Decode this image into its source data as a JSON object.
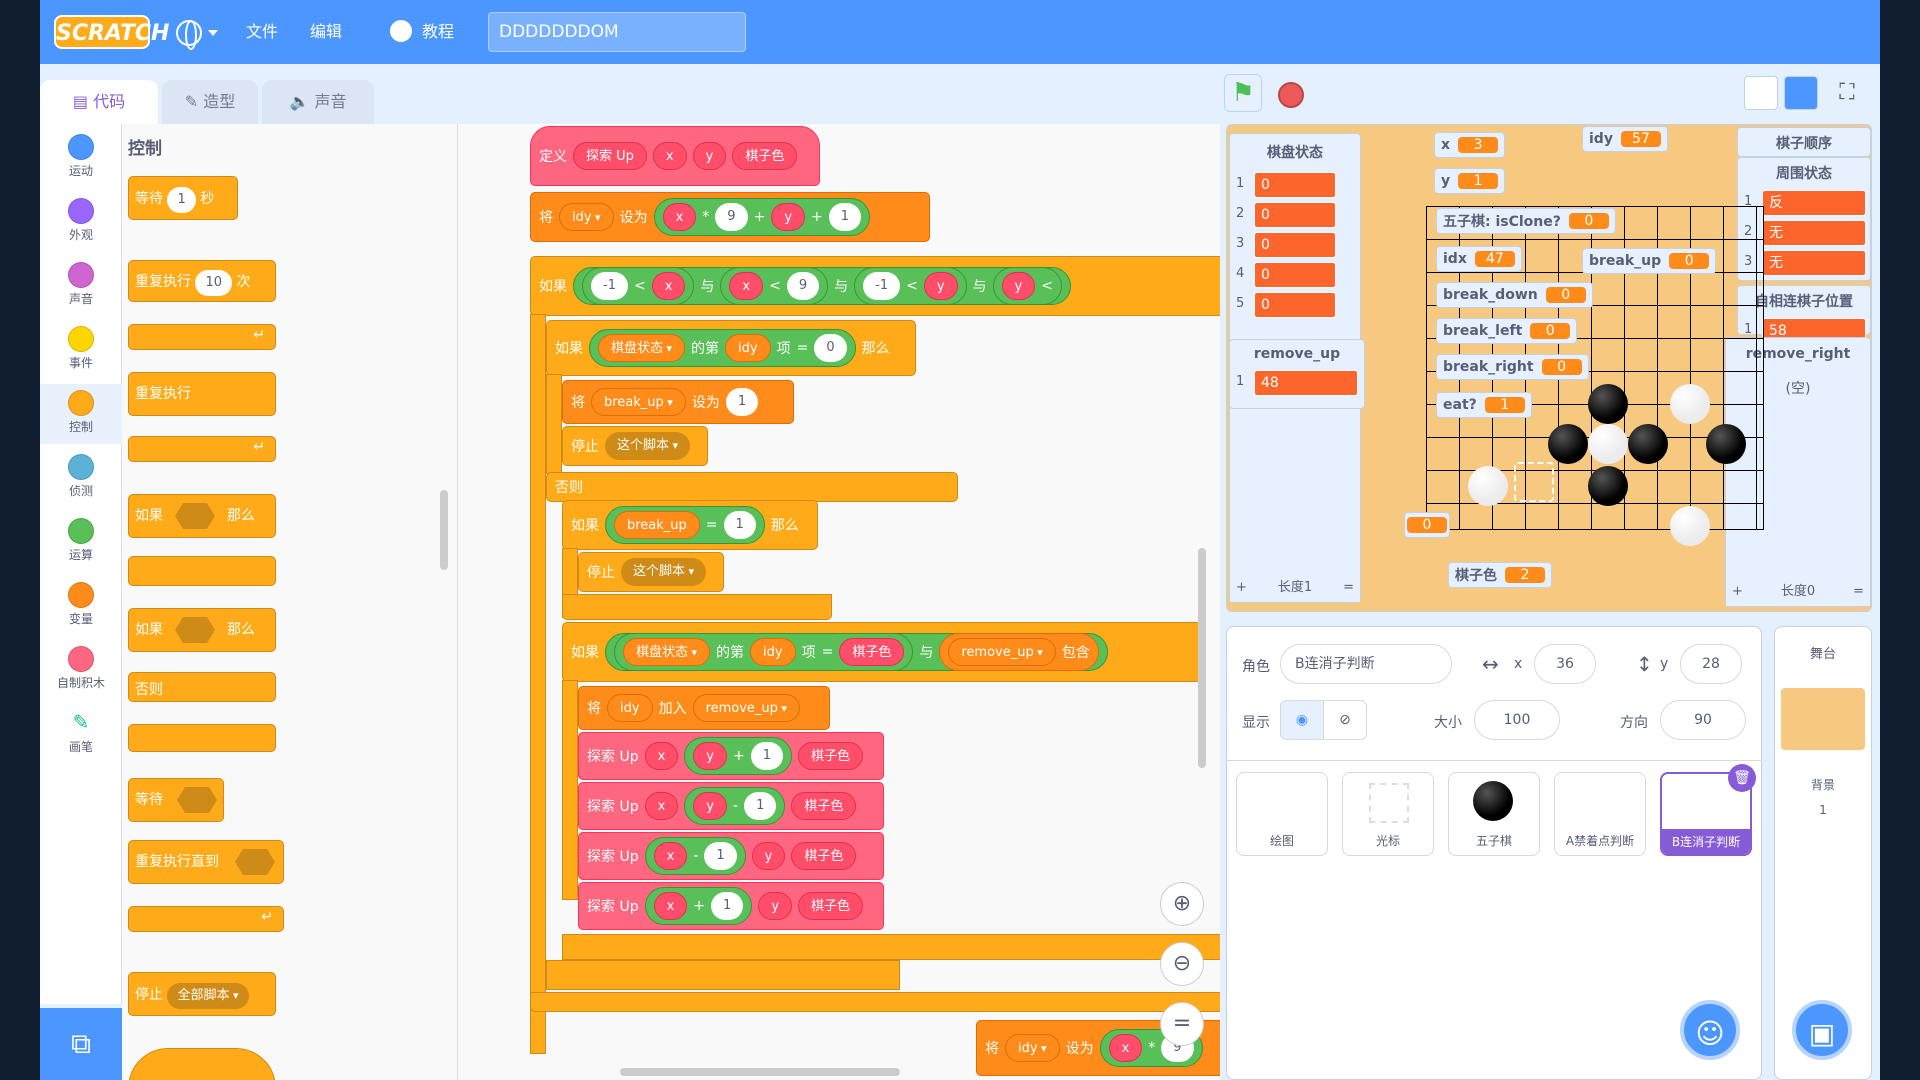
{
  "menubar": {
    "logo": "SCRATCH",
    "file": "文件",
    "edit": "编辑",
    "tutorials": "教程",
    "project_title": "DDDDDDDOM"
  },
  "tabs": {
    "code": "代码",
    "costumes": "造型",
    "sounds": "声音"
  },
  "categories": [
    {
      "label": "运动",
      "color": "#4c97ff"
    },
    {
      "label": "外观",
      "color": "#9966ff"
    },
    {
      "label": "声音",
      "color": "#cf63cf"
    },
    {
      "label": "事件",
      "color": "#ffd500"
    },
    {
      "label": "控制",
      "color": "#ffab19"
    },
    {
      "label": "侦测",
      "color": "#5cb1d6"
    },
    {
      "label": "运算",
      "color": "#59c059"
    },
    {
      "label": "变量",
      "color": "#ff8c1a"
    },
    {
      "label": "自制积木",
      "color": "#ff6680"
    },
    {
      "label": "画笔",
      "color": "#0fbd8c"
    }
  ],
  "palette": {
    "title": "控制",
    "wait": "等待",
    "wait_val": "1",
    "seconds": "秒",
    "repeat": "重复执行",
    "repeat_val": "10",
    "times": "次",
    "forever": "重复执行",
    "if": "如果",
    "then": "那么",
    "if2": "如果",
    "then2": "那么",
    "else": "否则",
    "wait_until": "等待",
    "repeat_until": "重复执行直到",
    "stop": "停止",
    "stop_all": "全部脚本"
  },
  "script": {
    "define": "定义",
    "proc_name": "探索 Up",
    "x": "x",
    "y": "y",
    "color": "棋子色",
    "set": "将",
    "idy": "idy",
    "set_to": "设为",
    "times": "*",
    "nine": "9",
    "plus": "+",
    "one": "1",
    "if": "如果",
    "neg1": "-1",
    "lt": "<",
    "and": "与",
    "board_state": "棋盘状态",
    "item_of": "的第",
    "item": "项",
    "eq": "=",
    "zero": "0",
    "then": "那么",
    "break_up": "break_up",
    "stop": "停止",
    "this_script": "这个脚本",
    "else": "否则",
    "remove_up": "remove_up",
    "contains": "包含",
    "add": "加入",
    "minus": "-"
  },
  "stage": {
    "lists": {
      "board_state": {
        "title": "棋盘状态",
        "rows": [
          "0",
          "0",
          "0",
          "0",
          "0"
        ],
        "length": "长度1"
      },
      "remove_up": {
        "title": "remove_up",
        "rows": [
          "48"
        ]
      },
      "piece_order": {
        "title": "棋子顺序"
      },
      "around_state": {
        "title": "周围状态",
        "rows": [
          "反",
          "无",
          "无"
        ]
      },
      "adjacent_pos": {
        "title": "自相连棋子位置",
        "rows": [
          "58"
        ]
      },
      "remove_right": {
        "title": "remove_right",
        "empty": "(空)",
        "length": "长度0"
      }
    },
    "vars": {
      "x": {
        "label": "x",
        "value": "3"
      },
      "y": {
        "label": "y",
        "value": "1"
      },
      "idy": {
        "label": "idy",
        "value": "57"
      },
      "isclone": {
        "label": "五子棋: isClone?",
        "value": "0"
      },
      "idx": {
        "label": "idx",
        "value": "47"
      },
      "break_up": {
        "label": "break_up",
        "value": "0"
      },
      "break_down": {
        "label": "break_down",
        "value": "0"
      },
      "break_left": {
        "label": "break_left",
        "value": "0"
      },
      "break_right": {
        "label": "break_right",
        "value": "0"
      },
      "eat": {
        "label": "eat?",
        "value": "1"
      },
      "lone": {
        "value": "0"
      },
      "piece_color": {
        "label": "棋子色",
        "value": "2"
      }
    }
  },
  "sprite_info": {
    "sprite_label": "角色",
    "sprite_name": "B连消子判断",
    "x_label": "x",
    "x": "36",
    "y_label": "y",
    "y": "28",
    "show_label": "显示",
    "size_label": "大小",
    "size": "100",
    "direction_label": "方向",
    "direction": "90"
  },
  "sprites": [
    "绘图",
    "光标",
    "五子棋",
    "A禁着点判断",
    "B连消子判断"
  ],
  "stage_pane": {
    "title": "舞台",
    "backdrop_label": "背景",
    "backdrop_count": "1"
  },
  "colors": {
    "accent": "#4c97ff",
    "control": "#ffab19",
    "variables": "#ff8c1a",
    "custom": "#ff6680",
    "operators": "#59c059"
  }
}
